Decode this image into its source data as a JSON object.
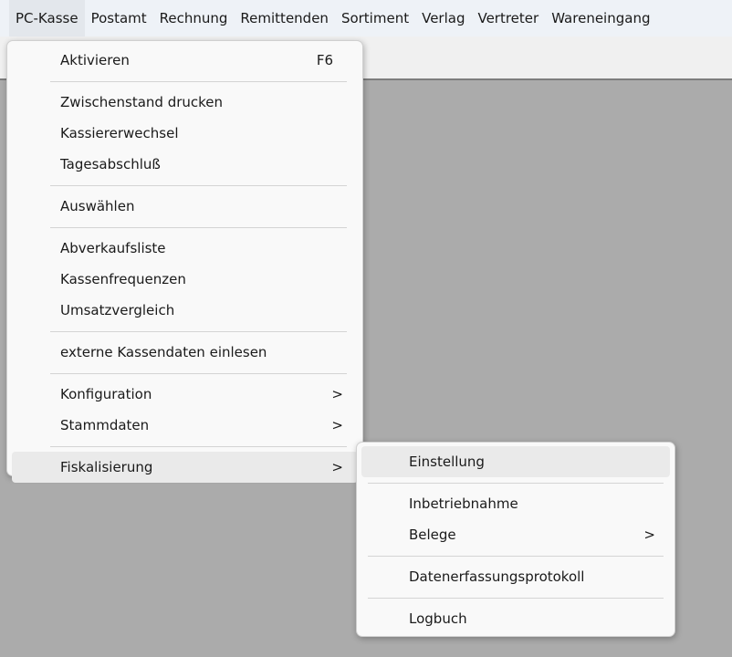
{
  "menubar": {
    "items": [
      "PC-Kasse",
      "Postamt",
      "Rechnung",
      "Remittenden",
      "Sortiment",
      "Verlag",
      "Vertreter",
      "Wareneingang"
    ]
  },
  "main_menu": {
    "aktivieren": {
      "label": "Aktivieren",
      "shortcut": "F6"
    },
    "zwischenstand": {
      "label": "Zwischenstand drucken"
    },
    "kassiererwechsel": {
      "label": "Kassiererwechsel"
    },
    "tagesabschluss": {
      "label": "Tagesabschluß"
    },
    "auswaehlen": {
      "label": "Auswählen"
    },
    "abverkaufsliste": {
      "label": "Abverkaufsliste"
    },
    "kassenfrequenzen": {
      "label": "Kassenfrequenzen"
    },
    "umsatzvergleich": {
      "label": "Umsatzvergleich"
    },
    "externe": {
      "label": "externe Kassendaten einlesen"
    },
    "konfiguration": {
      "label": "Konfiguration",
      "arrow": ">"
    },
    "stammdaten": {
      "label": "Stammdaten",
      "arrow": ">"
    },
    "fiskalisierung": {
      "label": "Fiskalisierung",
      "arrow": ">"
    }
  },
  "sub_menu": {
    "einstellung": {
      "label": "Einstellung"
    },
    "inbetriebnahme": {
      "label": "Inbetriebnahme"
    },
    "belege": {
      "label": "Belege",
      "arrow": ">"
    },
    "datenerfassung": {
      "label": "Datenerfassungsprotokoll"
    },
    "logbuch": {
      "label": "Logbuch"
    }
  }
}
